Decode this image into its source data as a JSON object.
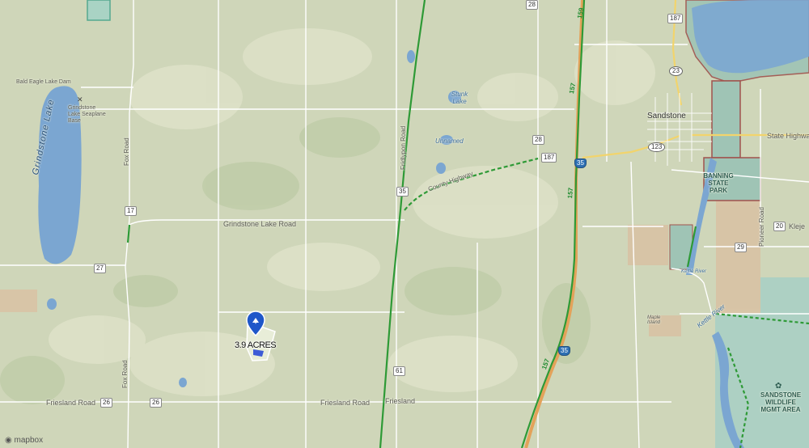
{
  "map": {
    "labels": {
      "bald_eagle": "Bald Eagle Lake Dam",
      "seaplane": "Grindstone Lake Seaplane Base",
      "grindstone_lake": "Grindstone Lake",
      "fox_road_n": "Fox Road",
      "fox_road_s": "Fox Road",
      "grindstone_lake_road": "Grindstone Lake Road",
      "frilippon_road": "Fridlypon Road",
      "stunk_lake": "Stunk Lake",
      "unnamed": "Unnamed",
      "county_hwy": "County Highway",
      "sandstone": "Sandstone",
      "state_highway": "State Highway",
      "banning": "BANNING STATE PARK",
      "friesland_road_w": "Friesland Road",
      "friesland_road_e": "Friesland Road",
      "friesland": "Friesland",
      "kettle_river": "Kettle River",
      "wildlife": "SANDSTONE WILDLIFE MGMT AREA",
      "pioneer_road": "Pioneer Road",
      "kleje": "Kleje",
      "maple_island": "Maple Island",
      "kettle_river_2": "Kettle River"
    },
    "shields": {
      "r28_top": "28",
      "r187_top": "187",
      "r23": "23",
      "r28_mid": "28",
      "r187_mid": "187",
      "i35_a": "35",
      "r123": "123",
      "r35_w": "35",
      "r17": "17",
      "r27": "27",
      "r20": "20",
      "r29": "29",
      "i35_b": "35",
      "r61": "61",
      "r26_a": "26",
      "r26_b": "26"
    },
    "trail_labels": {
      "t159": "159",
      "t157_a": "157",
      "t157_b": "157",
      "t157_c": "157"
    },
    "property": {
      "area_label": "3.9 ACRES"
    },
    "attribution": "mapbox"
  }
}
